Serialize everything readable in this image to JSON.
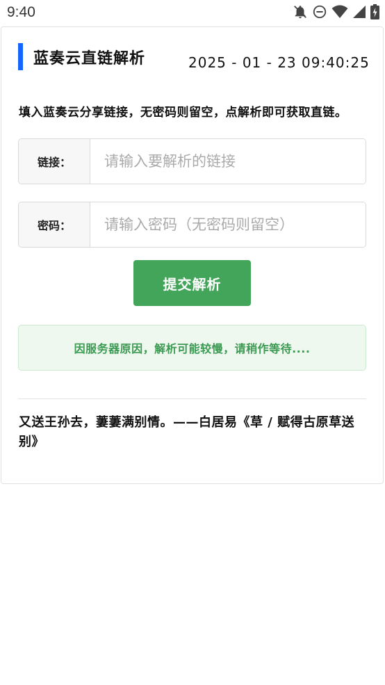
{
  "status_bar": {
    "time": "9:40",
    "icons": [
      "notifications-off-icon",
      "do-not-disturb-icon",
      "wifi-icon",
      "signal-icon",
      "battery-charging-icon"
    ]
  },
  "header": {
    "title": "蓝奏云直链解析",
    "datetime": "2025 - 01 - 23 09:40:25"
  },
  "description": "填入蓝奏云分享链接，无密码则留空，点解析即可获取直链。",
  "form": {
    "link_label": "链接：",
    "link_placeholder": "请输入要解析的链接",
    "password_label": "密码：",
    "password_placeholder": "请输入密码（无密码则留空）",
    "submit_label": "提交解析"
  },
  "notice": "因服务器原因，解析可能较慢，请稍作等待....",
  "footer_quote": "又送王孙去，萋萋满别情。——白居易《草 / 赋得古原草送别》",
  "colors": {
    "accent": "#1565ff",
    "button": "#43a55a",
    "notice_bg": "#eef8ef",
    "notice_text": "#3c9a52"
  }
}
